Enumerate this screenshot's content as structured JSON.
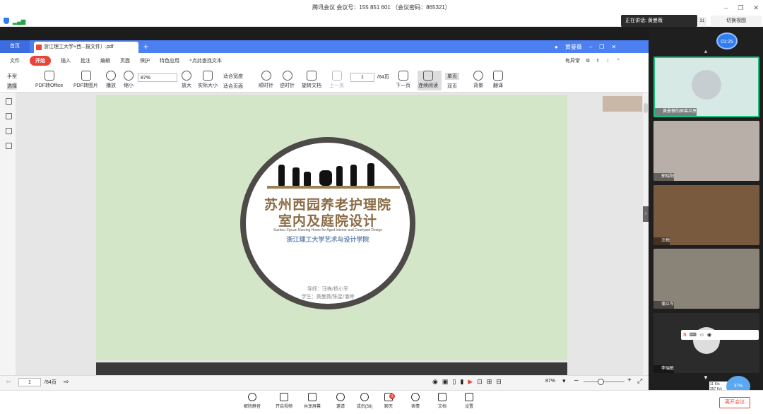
{
  "meeting": {
    "title": "腾讯会议 会议号：155 851 601 （会议密码：865321）",
    "speaking": "正在讲话: 黄曼薇",
    "speaker_count": "31",
    "switch_view": "切换视图",
    "timer": "01:25"
  },
  "pdf": {
    "home_tab": "首页",
    "doc_tab": "浙江理工大学+西...报文件）.pdf",
    "user": "黄曼薇",
    "menus": [
      "文件",
      "开始",
      "插入",
      "批注",
      "编辑",
      "页面",
      "保护",
      "特色应用"
    ],
    "search": "点此查找文本",
    "anomaly": "有异常",
    "tools": {
      "hand": "手型",
      "select": "选择",
      "pdf_office": "PDF转Office",
      "pdf_image": "PDF转图片",
      "play": "播放",
      "zoom_out": "缩小",
      "zoom_in": "放大",
      "actual": "实际大小",
      "fit_width": "适合宽度",
      "fit_page": "适合页面",
      "rot_cw": "顺时针",
      "rot_ccw": "逆时针",
      "rotate_doc": "旋转文档",
      "prev": "上一页",
      "next": "下一页",
      "continuous": "连续阅读",
      "single": "单页",
      "double": "双页",
      "background": "背景",
      "translate": "翻译"
    },
    "zoom": "87%",
    "page": "1",
    "total": "/64页",
    "status_total": "/64页",
    "status_zoom": "87%"
  },
  "slide": {
    "title_line1": "苏州西园养老护理院",
    "title_line2": "室内及庭院设计",
    "english": "Suzhou Xiyuan Nursing Home for  Aged  Interior and Courtyard Design",
    "school": "浙江理工大学艺术与设计学院",
    "advisors": "导师：汪梅/杨小军",
    "students": "学生：黄曼薇/陈星/潘婷"
  },
  "participants": [
    {
      "name": "黄曼薇的屏幕共享"
    },
    {
      "name": "郭晓阳"
    },
    {
      "name": "汪梅"
    },
    {
      "name": "蒲立军"
    },
    {
      "name": "李瑞敏"
    }
  ],
  "net": {
    "up": "11 K/s",
    "down": "357 K/s",
    "percent": "37%"
  },
  "controls": {
    "mute": "解除静音",
    "video": "开启视频",
    "share": "共享屏幕",
    "invite": "邀请",
    "members": "成员(58)",
    "chat": "聊天",
    "chat_badge": "1",
    "reaction": "表情",
    "docs": "文档",
    "settings": "设置",
    "leave": "离开会议"
  }
}
